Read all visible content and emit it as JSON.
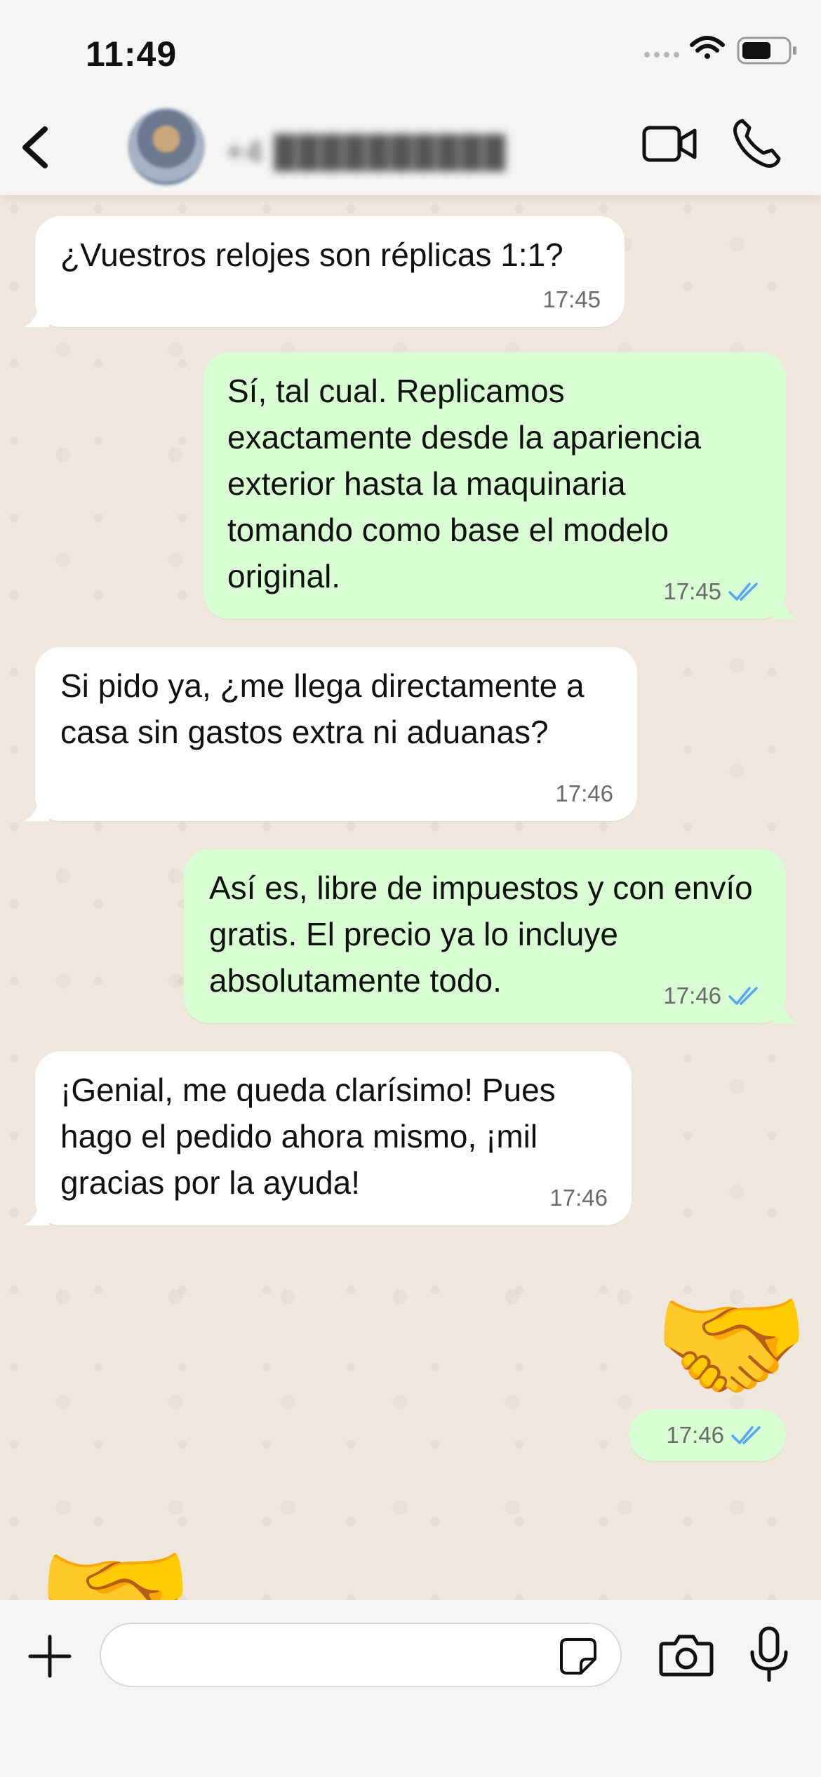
{
  "status_bar": {
    "time": "11:49"
  },
  "header": {
    "contact_name": "+4 ██████████"
  },
  "messages": [
    {
      "direction": "in",
      "text": "¿Vuestros relojes son réplicas 1:1?",
      "time": "17:45"
    },
    {
      "direction": "out",
      "text": "Sí, tal cual. Replicamos exactamente desde la apariencia exterior hasta la maquinaria tomando como base el modelo original.",
      "time": "17:45",
      "status": "read"
    },
    {
      "direction": "in",
      "text": "Si pido ya, ¿me llega directamente a casa sin gastos extra ni aduanas?",
      "time": "17:46"
    },
    {
      "direction": "out",
      "text": "Así es, libre de impuestos y con envío gratis. El precio ya lo incluye absolutamente todo.",
      "time": "17:46",
      "status": "read"
    },
    {
      "direction": "in",
      "text": "¡Genial, me queda clarísimo! Pues hago el pedido ahora mismo, ¡mil gracias por la ayuda!",
      "time": "17:46"
    },
    {
      "direction": "out",
      "emoji": "🤝",
      "time": "17:46",
      "status": "read"
    },
    {
      "direction": "in",
      "emoji": "🤝"
    }
  ],
  "colors": {
    "outgoing_bubble": "#d9fdd3",
    "incoming_bubble": "#ffffff",
    "read_ticks": "#53a6fa",
    "chat_background": "#efe7dd",
    "bar_background": "#f6f5f3"
  },
  "icons": {
    "back": "chevron-left-icon",
    "video": "video-camera-icon",
    "call": "phone-icon",
    "plus": "plus-icon",
    "sticker": "sticker-icon",
    "camera": "camera-icon",
    "mic": "microphone-icon"
  }
}
